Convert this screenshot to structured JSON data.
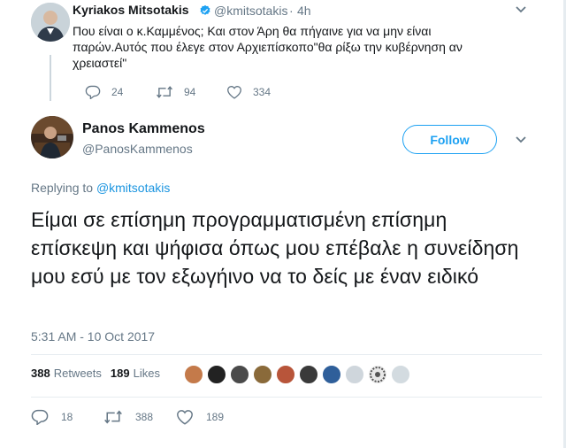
{
  "parent_tweet": {
    "author_name": "Kyriakos Mitsotakis",
    "author_handle": "@kmitsotakis",
    "separator": "·",
    "time": "4h",
    "text": "Που είναι ο κ.Καμμένος; Και στον Άρη θα πήγαινε για να μην είναι παρών.Αυτός που έλεγε στον Αρχιεπίσκοπο\"θα ρίξω την κυβέρνηση αν χρειαστεί\"",
    "replies": "24",
    "retweets": "94",
    "likes": "334",
    "icons": {
      "reply": "reply-icon",
      "retweet": "retweet-icon",
      "like": "heart-icon",
      "verified": "verified-badge-icon",
      "menu": "chevron-down-icon"
    }
  },
  "main_tweet": {
    "author_name": "Panos Kammenos",
    "author_handle": "@PanosKammenos",
    "follow_label": "Follow",
    "replying_prefix": "Replying to",
    "replying_to": "@kmitsotakis",
    "text": "Είμαι σε επίσημη προγραμματισμένη επίσημη επίσκεψη και ψήφισα όπως μου επέβαλε η συνείδηση μου εσύ με τον εξωγήινο να το δείς με έναν ειδικό",
    "timestamp": "5:31 AM - 10 Oct 2017",
    "retweet_count": "388",
    "retweet_label": "Retweets",
    "like_count": "189",
    "like_label": "Likes",
    "replies": "18",
    "retweets": "388",
    "likes": "189",
    "liker_avatars_count": 10
  },
  "colors": {
    "accent": "#1da1f2",
    "text": "#14171a",
    "secondary": "#657786",
    "divider": "#e6ecf0"
  }
}
